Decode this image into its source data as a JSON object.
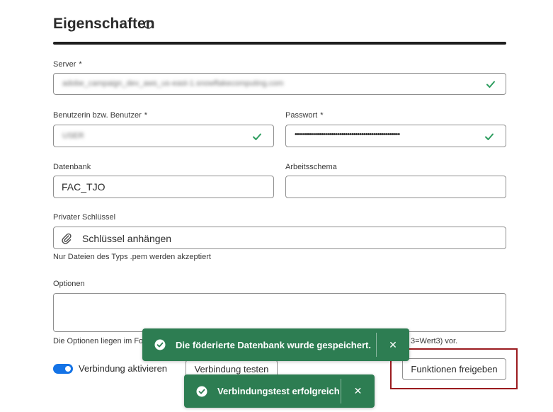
{
  "header": {
    "title": "Eigenschaften",
    "info_icon": "info-icon"
  },
  "fields": {
    "server": {
      "label": "Server",
      "required_mark": "*",
      "value_blurred": "adobe_campaign_dev_aws_us-east-1.snowflakecomputing.com"
    },
    "user": {
      "label": "Benutzerin bzw. Benutzer",
      "required_mark": "*",
      "value_blurred": "USER"
    },
    "password": {
      "label": "Passwort",
      "required_mark": "*",
      "value": "••••••••••••••••••••••••••••••••••••••••••••••••••••"
    },
    "database": {
      "label": "Datenbank",
      "value": "FAC_TJO"
    },
    "schema": {
      "label": "Arbeitsschema",
      "value": ""
    },
    "private_key": {
      "label": "Privater Schlüssel",
      "button_label": "Schlüssel anhängen",
      "hint": "Nur Dateien des Typs .pem werden akzeptiert"
    },
    "options": {
      "label": "Optionen",
      "value": "",
      "hint_left": "Die Optionen liegen im Fo",
      "hint_right": "3=Wert3) vor."
    }
  },
  "controls": {
    "toggle_label": "Verbindung aktivieren",
    "toggle_on": true,
    "test_button": "Verbindung testen",
    "functions_button": "Funktionen freigeben"
  },
  "toasts": [
    {
      "message": "Die föderierte Datenbank wurde gespeichert.",
      "close": "✕"
    },
    {
      "message": "Verbindungstest erfolgreich",
      "close": "✕"
    }
  ],
  "colors": {
    "success": "#2d7d52",
    "check": "#2d9d5f",
    "toggle": "#1473e6",
    "highlight": "#9b1b1f"
  }
}
